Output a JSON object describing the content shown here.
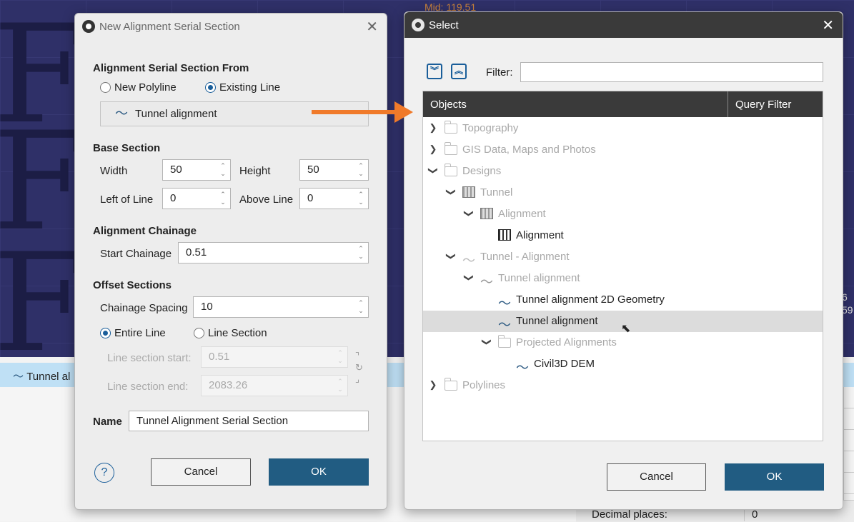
{
  "background": {
    "mid_label": "Mid: 119.51",
    "strip_label": "Tunnel al",
    "num_a": "6",
    "num_b": "59",
    "props_label": "Decimal places:",
    "props_value": "0"
  },
  "new_dialog": {
    "title": "New Alignment Serial Section",
    "from_section": "Alignment Serial Section From",
    "radio_new": "New Polyline",
    "radio_existing": "Existing Line",
    "selected_line": "Tunnel alignment",
    "base_section": "Base Section",
    "width_label": "Width",
    "width_value": "50",
    "height_label": "Height",
    "height_value": "50",
    "left_label": "Left of Line",
    "left_value": "0",
    "above_label": "Above Line",
    "above_value": "0",
    "chainage_section": "Alignment Chainage",
    "start_label": "Start Chainage",
    "start_value": "0.51",
    "offset_section": "Offset Sections",
    "spacing_label": "Chainage Spacing",
    "spacing_value": "10",
    "radio_entire": "Entire Line",
    "radio_linesec": "Line Section",
    "ls_start_label": "Line section start:",
    "ls_start_value": "0.51",
    "ls_end_label": "Line section end:",
    "ls_end_value": "2083.26",
    "name_label": "Name",
    "name_value": "Tunnel Alignment Serial Section",
    "help": "?",
    "cancel": "Cancel",
    "ok": "OK"
  },
  "select_dialog": {
    "title": "Select",
    "filter_label": "Filter:",
    "filter_value": "",
    "col_objects": "Objects",
    "col_query": "Query Filter",
    "tree": [
      {
        "label": "Topography",
        "dim": true
      },
      {
        "label": "GIS Data, Maps and Photos",
        "dim": true
      },
      {
        "label": "Designs",
        "dim": true
      },
      {
        "label": "Tunnel",
        "dim": true
      },
      {
        "label": "Alignment",
        "dim": true
      },
      {
        "label": "Alignment",
        "dim": false
      },
      {
        "label": "Tunnel - Alignment",
        "dim": true
      },
      {
        "label": "Tunnel alignment",
        "dim": true
      },
      {
        "label": "Tunnel alignment 2D Geometry",
        "dim": false
      },
      {
        "label": "Tunnel alignment",
        "dim": false,
        "selected": true
      },
      {
        "label": "Projected Alignments",
        "dim": true
      },
      {
        "label": "Civil3D DEM",
        "dim": false
      },
      {
        "label": "Polylines",
        "dim": true
      }
    ],
    "cancel": "Cancel",
    "ok": "OK"
  },
  "colors": {
    "accent": "#215c82",
    "arrow": "#f07a2a",
    "header": "#3a3a3a"
  }
}
